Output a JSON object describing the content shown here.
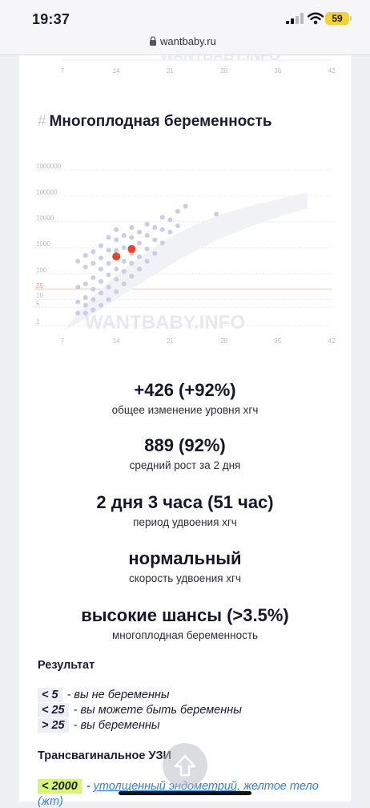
{
  "status_bar": {
    "time": "19:37",
    "battery": "59"
  },
  "browser": {
    "url": "wantbaby.ru"
  },
  "top_chart": {
    "x_ticks": [
      "7",
      "14",
      "21",
      "28",
      "35",
      "42"
    ]
  },
  "section": {
    "hash": "#",
    "title": "Многоплодная беременность"
  },
  "chart_data": {
    "type": "scatter",
    "y_scale": "log",
    "y_ticks": [
      "1000000",
      "100000",
      "10000",
      "1000",
      "100",
      "25",
      "10",
      "5",
      "1"
    ],
    "x_ticks": [
      "7",
      "14",
      "21",
      "28",
      "35",
      "42"
    ],
    "xlim": [
      7,
      42
    ],
    "ylim": [
      1,
      1000000
    ],
    "watermark": "WANTBABY.INFO",
    "highlight_color": "#e8442c",
    "cloud_color": "#c9cde6",
    "highlighted_points": [
      {
        "x": 14,
        "y": 460
      },
      {
        "x": 16,
        "y": 889
      }
    ],
    "reference_points": [
      {
        "x": 9,
        "y": 3
      },
      {
        "x": 9,
        "y": 8
      },
      {
        "x": 9,
        "y": 30
      },
      {
        "x": 9,
        "y": 300
      },
      {
        "x": 10,
        "y": 3
      },
      {
        "x": 10,
        "y": 6
      },
      {
        "x": 10,
        "y": 12
      },
      {
        "x": 10,
        "y": 40
      },
      {
        "x": 10,
        "y": 180
      },
      {
        "x": 10,
        "y": 500
      },
      {
        "x": 11,
        "y": 4
      },
      {
        "x": 11,
        "y": 10
      },
      {
        "x": 11,
        "y": 25
      },
      {
        "x": 11,
        "y": 70
      },
      {
        "x": 11,
        "y": 250
      },
      {
        "x": 11,
        "y": 700
      },
      {
        "x": 12,
        "y": 6
      },
      {
        "x": 12,
        "y": 18
      },
      {
        "x": 12,
        "y": 50
      },
      {
        "x": 12,
        "y": 150
      },
      {
        "x": 12,
        "y": 400
      },
      {
        "x": 12,
        "y": 1200
      },
      {
        "x": 13,
        "y": 10
      },
      {
        "x": 13,
        "y": 30
      },
      {
        "x": 13,
        "y": 90
      },
      {
        "x": 13,
        "y": 250
      },
      {
        "x": 13,
        "y": 800
      },
      {
        "x": 13,
        "y": 2500
      },
      {
        "x": 14,
        "y": 20
      },
      {
        "x": 14,
        "y": 60
      },
      {
        "x": 14,
        "y": 150
      },
      {
        "x": 14,
        "y": 800
      },
      {
        "x": 14,
        "y": 2000
      },
      {
        "x": 14,
        "y": 5000
      },
      {
        "x": 15,
        "y": 40
      },
      {
        "x": 15,
        "y": 120
      },
      {
        "x": 15,
        "y": 300
      },
      {
        "x": 15,
        "y": 1000
      },
      {
        "x": 15,
        "y": 3000
      },
      {
        "x": 16,
        "y": 80
      },
      {
        "x": 16,
        "y": 250
      },
      {
        "x": 16,
        "y": 600
      },
      {
        "x": 16,
        "y": 2500
      },
      {
        "x": 16,
        "y": 6000
      },
      {
        "x": 17,
        "y": 150
      },
      {
        "x": 17,
        "y": 450
      },
      {
        "x": 17,
        "y": 1500
      },
      {
        "x": 17,
        "y": 4000
      },
      {
        "x": 18,
        "y": 300
      },
      {
        "x": 18,
        "y": 900
      },
      {
        "x": 18,
        "y": 3000
      },
      {
        "x": 18,
        "y": 8000
      },
      {
        "x": 19,
        "y": 600
      },
      {
        "x": 19,
        "y": 2000
      },
      {
        "x": 19,
        "y": 6000
      },
      {
        "x": 20,
        "y": 1500
      },
      {
        "x": 20,
        "y": 5000
      },
      {
        "x": 20,
        "y": 15000
      },
      {
        "x": 21,
        "y": 4000
      },
      {
        "x": 21,
        "y": 12000
      },
      {
        "x": 22,
        "y": 7000
      },
      {
        "x": 22,
        "y": 25000
      },
      {
        "x": 23,
        "y": 40000
      },
      {
        "x": 27,
        "y": 20000
      }
    ]
  },
  "stats": [
    {
      "value": "+426 (+92%)",
      "label": "общее изменение уровня хгч"
    },
    {
      "value": "889 (92%)",
      "label": "средний рост за 2 дня"
    },
    {
      "value": "2 дня 3 часа (51 час)",
      "label": "период удвоения хгч"
    },
    {
      "value": "нормальный",
      "label": "скорость удвоения хгч"
    },
    {
      "value": "высокие шансы (>3.5%)",
      "label": "многоплодная беременность"
    }
  ],
  "result": {
    "heading": "Результат",
    "rows": [
      {
        "code": "< 5",
        "text": "- вы не беременны"
      },
      {
        "code": "< 25",
        "text": "- вы можете быть беременны"
      },
      {
        "code": "> 25",
        "text": "- вы беременны"
      }
    ]
  },
  "ultrasound": {
    "heading": "Трансвагинальное УЗИ",
    "code": "< 2000",
    "dash": "-",
    "link1": "утолщенный эндометрий,",
    "link2": "желтое тело",
    "line2": "(жт)"
  }
}
